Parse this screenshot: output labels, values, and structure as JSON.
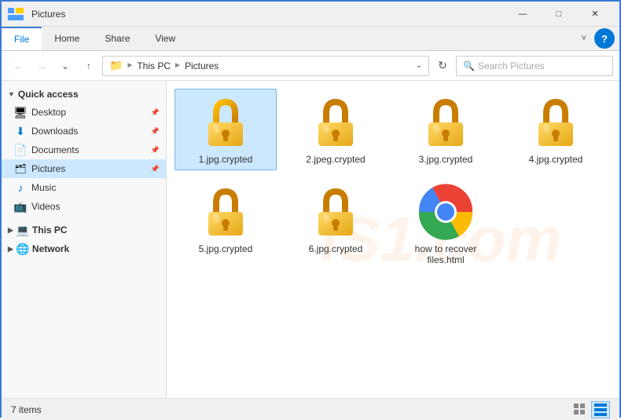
{
  "titlebar": {
    "title": "Pictures",
    "minimize_label": "—",
    "maximize_label": "□",
    "close_label": "✕"
  },
  "ribbon": {
    "tabs": [
      {
        "label": "File",
        "active": true
      },
      {
        "label": "Home",
        "active": false
      },
      {
        "label": "Share",
        "active": false
      },
      {
        "label": "View",
        "active": false
      }
    ],
    "help_label": "?"
  },
  "addressbar": {
    "back_btn": "←",
    "forward_btn": "→",
    "dropdown_btn": "˅",
    "up_btn": "↑",
    "breadcrumb": {
      "this_pc": "This PC",
      "pictures": "Pictures"
    },
    "dropdown_arrow": "˅",
    "refresh_btn": "↻",
    "search_placeholder": "Search Pictures"
  },
  "sidebar": {
    "quick_access_label": "Quick access",
    "items": [
      {
        "id": "desktop",
        "label": "Desktop",
        "icon": "🖥",
        "pinned": true
      },
      {
        "id": "downloads",
        "label": "Downloads",
        "icon": "📥",
        "pinned": true
      },
      {
        "id": "documents",
        "label": "Documents",
        "icon": "📄",
        "pinned": true
      },
      {
        "id": "pictures",
        "label": "Pictures",
        "icon": "🗂",
        "pinned": true,
        "selected": true
      },
      {
        "id": "music",
        "label": "Music",
        "icon": "🎵",
        "pinned": false
      },
      {
        "id": "videos",
        "label": "Videos",
        "icon": "📺",
        "pinned": false
      }
    ],
    "this_pc_label": "This PC",
    "network_label": "Network"
  },
  "content": {
    "watermark_text": "iS1.com",
    "files": [
      {
        "id": "f1",
        "label": "1.jpg.crypted",
        "type": "lock",
        "selected": true
      },
      {
        "id": "f2",
        "label": "2.jpeg.crypted",
        "type": "lock",
        "selected": false
      },
      {
        "id": "f3",
        "label": "3.jpg.crypted",
        "type": "lock",
        "selected": false
      },
      {
        "id": "f4",
        "label": "4.jpg.crypted",
        "type": "lock",
        "selected": false
      },
      {
        "id": "f5",
        "label": "5.jpg.crypted",
        "type": "lock",
        "selected": false
      },
      {
        "id": "f6",
        "label": "6.jpg.crypted",
        "type": "lock",
        "selected": false
      },
      {
        "id": "f7",
        "label": "how to recover files.html",
        "type": "chrome",
        "selected": false
      }
    ]
  },
  "statusbar": {
    "count_label": "7 items",
    "view_large_icon": "⊞",
    "view_list_icon": "≡"
  }
}
